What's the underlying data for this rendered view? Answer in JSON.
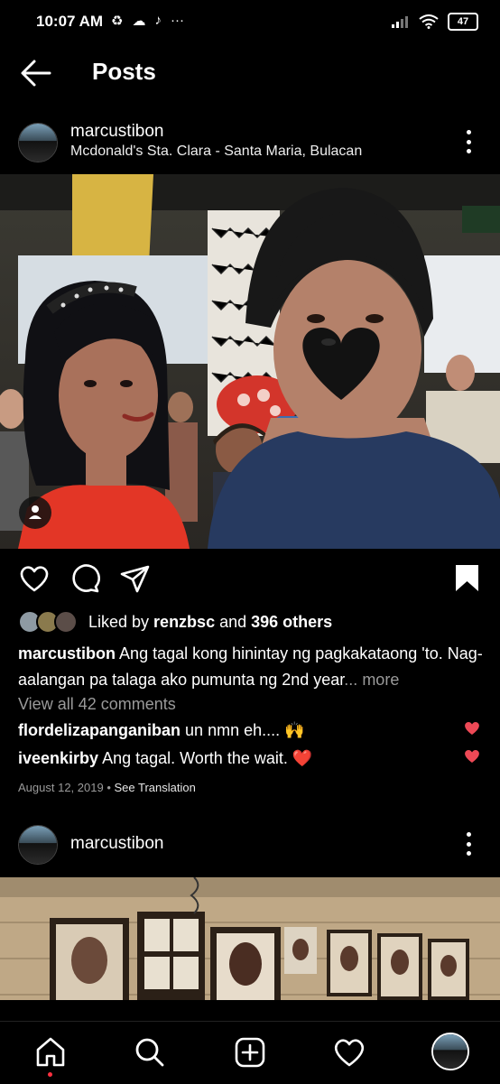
{
  "status_bar": {
    "time": "10:07 AM",
    "battery": "47"
  },
  "header": {
    "title": "Posts"
  },
  "post1": {
    "username": "marcustibon",
    "location": "Mcdonald's Sta. Clara - Santa Maria, Bulacan",
    "likes_prefix": "Liked by ",
    "liked_by_user": "renzbsc",
    "likes_and": " and ",
    "likes_others": "396 others",
    "caption_user": "marcustibon",
    "caption_text": "Ang tagal kong hinintay ng pagkakataong 'to. Nag-aalangan pa talaga ako pumunta ng 2nd year",
    "caption_ellipsis": "...",
    "more_label": " more",
    "view_comments": "View all 42 comments",
    "comments": [
      {
        "user": "flordelizapanganiban",
        "text": "un nmn eh.... 🙌"
      },
      {
        "user": "iveenkirby",
        "text": "Ang tagal. Worth the wait. ❤️"
      }
    ],
    "date": "August 12, 2019",
    "date_sep": " • ",
    "see_translation": "See Translation"
  },
  "post2": {
    "username": "marcustibon"
  },
  "nav": {
    "items": [
      "home-icon",
      "search-icon",
      "create-icon",
      "activity-heart-icon",
      "profile-avatar"
    ]
  },
  "colors": {
    "background": "#000000",
    "like_red": "#ED4956",
    "muted_text": "#9A9A9A",
    "notification_dot": "#FF3040"
  }
}
